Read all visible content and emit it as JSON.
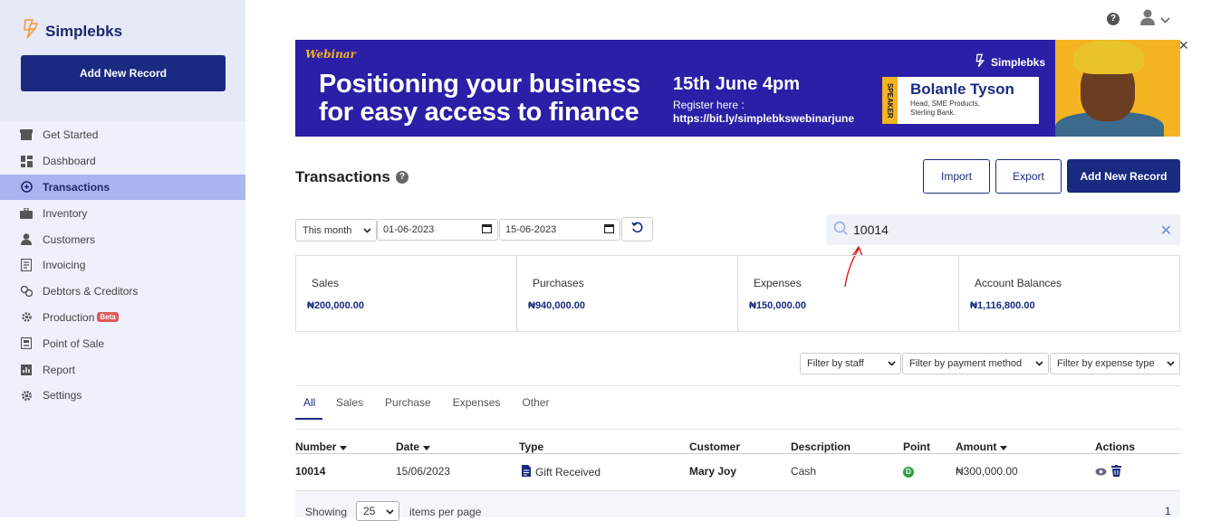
{
  "app": {
    "name": "Simplebks"
  },
  "sidebar": {
    "add_button": "Add New Record",
    "items": [
      {
        "label": "Get Started",
        "icon": "store-icon"
      },
      {
        "label": "Dashboard",
        "icon": "dashboard-icon"
      },
      {
        "label": "Transactions",
        "icon": "transactions-icon",
        "active": true
      },
      {
        "label": "Inventory",
        "icon": "briefcase-icon"
      },
      {
        "label": "Customers",
        "icon": "user-icon"
      },
      {
        "label": "Invoicing",
        "icon": "invoice-icon"
      },
      {
        "label": "Debtors & Creditors",
        "icon": "people-icon"
      },
      {
        "label": "Production",
        "icon": "gear-icon",
        "badge": "Beta"
      },
      {
        "label": "Point of Sale",
        "icon": "pos-icon"
      },
      {
        "label": "Report",
        "icon": "report-icon"
      },
      {
        "label": "Settings",
        "icon": "settings-icon"
      }
    ]
  },
  "banner": {
    "tag": "Webinar",
    "headline_line1": "Positioning your business",
    "headline_line2": "for easy access to finance",
    "date": "15th June 4pm",
    "register_label": "Register here :",
    "register_url": "https://bit.ly/simplebkswebinarjune",
    "brand": "Simplebks",
    "speaker_tag": "SPEAKER",
    "speaker_name": "Bolanle Tyson",
    "speaker_role_line1": "Head, SME Products,",
    "speaker_role_line2": "Sterling Bank."
  },
  "page": {
    "title": "Transactions",
    "import_label": "Import",
    "export_label": "Export",
    "add_label": "Add New Record"
  },
  "filters": {
    "period": "This month",
    "date_from": "01-06-2023",
    "date_to": "15-06-2023",
    "search_value": "10014",
    "staff": "Filter by staff",
    "payment_method": "Filter by payment method",
    "expense_type": "Filter by expense type"
  },
  "summary": [
    {
      "label": "Sales",
      "value": "₦200,000.00"
    },
    {
      "label": "Purchases",
      "value": "₦940,000.00"
    },
    {
      "label": "Expenses",
      "value": "₦150,000.00"
    },
    {
      "label": "Account Balances",
      "value": "₦1,116,800.00"
    }
  ],
  "tabs": [
    "All",
    "Sales",
    "Purchase",
    "Expenses",
    "Other"
  ],
  "table": {
    "headers": {
      "number": "Number",
      "date": "Date",
      "type": "Type",
      "customer": "Customer",
      "description": "Description",
      "point": "Point",
      "amount": "Amount",
      "actions": "Actions"
    },
    "rows": [
      {
        "number": "10014",
        "date": "15/06/2023",
        "type": "Gift Received",
        "customer": "Mary Joy",
        "description": "Cash",
        "point": "D",
        "amount": "₦300,000.00"
      }
    ]
  },
  "footer": {
    "showing": "Showing",
    "per_page": "25",
    "items_label": "items per page",
    "page": "1"
  },
  "colors": {
    "primary": "#1a2a80",
    "active_nav": "#aab4ee",
    "banner_bg": "#2a1fa6",
    "accent": "#f4b321"
  }
}
